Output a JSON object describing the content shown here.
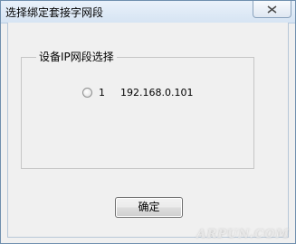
{
  "window": {
    "title": "选择绑定套接字网段",
    "close_icon": "close-icon"
  },
  "group": {
    "label": "设备IP网段选择"
  },
  "options": [
    {
      "index": "1",
      "ip": "192.168.0.101",
      "selected": false
    }
  ],
  "buttons": {
    "ok_label": "确定"
  },
  "watermark": {
    "text": "ARPUN.COM"
  },
  "colors": {
    "titlebar": "#dce8f5",
    "client_bg": "#f0f0f0",
    "frame": "#6f8fae"
  }
}
